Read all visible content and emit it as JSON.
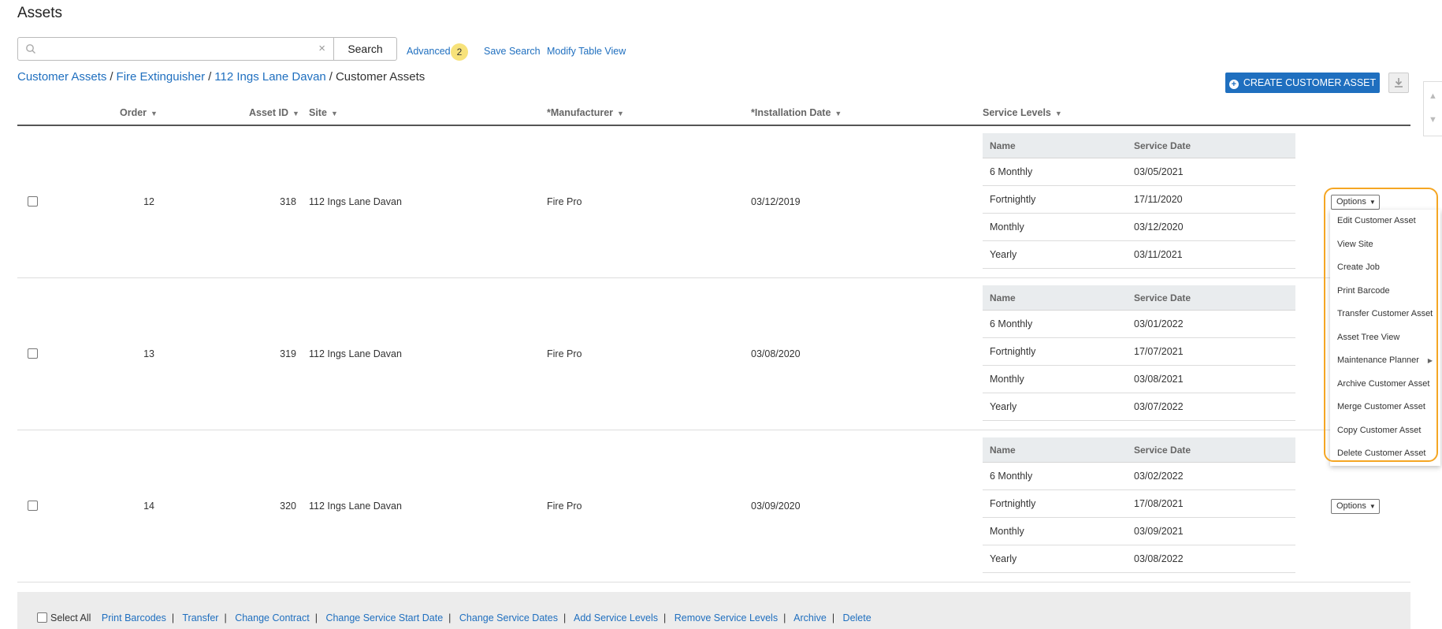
{
  "page": {
    "title": "Assets"
  },
  "search": {
    "placeholder": "",
    "value": "",
    "button_label": "Search",
    "advanced_label": "Advanced",
    "advanced_count": "2",
    "save_search_label": "Save Search",
    "modify_table_label": "Modify Table View"
  },
  "breadcrumb": {
    "items": [
      "Customer Assets",
      "Fire Extinguisher",
      "112 Ings Lane Davan"
    ],
    "current": "Customer Assets",
    "separator": "/"
  },
  "toolbar": {
    "create_label": "CREATE CUSTOMER ASSET",
    "export_icon": "download-icon"
  },
  "table": {
    "columns": [
      "Order",
      "Asset ID",
      "Site",
      "*Manufacturer",
      "*Installation Date",
      "Service Levels"
    ],
    "service_columns": [
      "Name",
      "Service Date"
    ],
    "rows": [
      {
        "order": "12",
        "asset_id": "318",
        "site": "112 Ings Lane Davan",
        "manufacturer": "Fire Pro",
        "installation_date": "03/12/2019",
        "service_levels": [
          {
            "name": "6 Monthly",
            "date": "03/05/2021"
          },
          {
            "name": "Fortnightly",
            "date": "17/11/2020"
          },
          {
            "name": "Monthly",
            "date": "03/12/2020"
          },
          {
            "name": "Yearly",
            "date": "03/11/2021"
          }
        ]
      },
      {
        "order": "13",
        "asset_id": "319",
        "site": "112 Ings Lane Davan",
        "manufacturer": "Fire Pro",
        "installation_date": "03/08/2020",
        "service_levels": [
          {
            "name": "6 Monthly",
            "date": "03/01/2022"
          },
          {
            "name": "Fortnightly",
            "date": "17/07/2021"
          },
          {
            "name": "Monthly",
            "date": "03/08/2021"
          },
          {
            "name": "Yearly",
            "date": "03/07/2022"
          }
        ]
      },
      {
        "order": "14",
        "asset_id": "320",
        "site": "112 Ings Lane Davan",
        "manufacturer": "Fire Pro",
        "installation_date": "03/09/2020",
        "service_levels": [
          {
            "name": "6 Monthly",
            "date": "03/02/2022"
          },
          {
            "name": "Fortnightly",
            "date": "17/08/2021"
          },
          {
            "name": "Monthly",
            "date": "03/09/2021"
          },
          {
            "name": "Yearly",
            "date": "03/08/2022"
          }
        ]
      }
    ],
    "options_label": "Options"
  },
  "options_menu": {
    "items": [
      "Edit Customer Asset",
      "View Site",
      "Create Job",
      "Print Barcode",
      "Transfer Customer Asset",
      "Asset Tree View",
      "Maintenance Planner",
      "Archive Customer Asset",
      "Merge Customer Asset",
      "Copy Customer Asset",
      "Delete Customer Asset"
    ]
  },
  "footer": {
    "select_all_label": "Select All",
    "actions": [
      "Print Barcodes",
      "Transfer",
      "Change Contract",
      "Change Service Start Date",
      "Change Service Dates",
      "Add Service Levels",
      "Remove Service Levels",
      "Archive",
      "Delete"
    ],
    "separator": "|"
  },
  "colors": {
    "accent": "#1f6fbf",
    "highlight": "#f5a623",
    "badge": "#f7e27a",
    "service_header_bg": "#e9ecee",
    "footer_bg": "#ececec"
  }
}
